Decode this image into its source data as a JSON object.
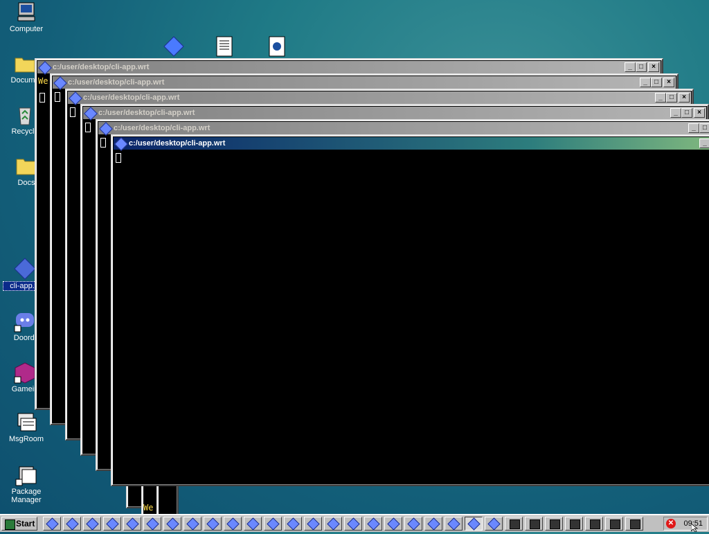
{
  "desktop": {
    "icons": [
      {
        "label": "Computer",
        "icon": "computer-icon"
      },
      {
        "label": "Docume",
        "icon": "folder-icon"
      },
      {
        "label": "Recycle",
        "icon": "recycle-bin-icon"
      },
      {
        "label": "Docs",
        "icon": "folder-icon"
      },
      {
        "label": "cli-app.w",
        "icon": "diamond-app-icon",
        "selected": true
      },
      {
        "label": "Doordi",
        "icon": "discord-shortcut-icon"
      },
      {
        "label": "Gamein",
        "icon": "cube-shortcut-icon"
      },
      {
        "label": "MsgRoom",
        "icon": "chat-icon"
      },
      {
        "label": "Package\nManager",
        "icon": "package-icon"
      }
    ]
  },
  "windows": [
    {
      "title": "c:/user/desktop/cli-app.wrt",
      "active": false,
      "welcome": "We"
    },
    {
      "title": "c:/user/desktop/cli-app.wrt",
      "active": false
    },
    {
      "title": "c:/user/desktop/cli-app.wrt",
      "active": false
    },
    {
      "title": "c:/user/desktop/cli-app.wrt",
      "active": false
    },
    {
      "title": "c:/user/desktop/cli-app.wrt",
      "active": false
    },
    {
      "title": "c:/user/desktop/cli-app.wrt",
      "active": true
    }
  ],
  "lower_window": {
    "welcome": "We"
  },
  "taskbar": {
    "start_label": "Start",
    "clock": "09:51",
    "task_count_diamond": 21,
    "task_count_terminal": 7
  },
  "colors": {
    "active_title_start": "#0a246a",
    "inactive_title": "#808080",
    "taskbar": "#c0c0c0",
    "terminal_bg": "#000000",
    "welcome_text": "#ffdc4a"
  }
}
